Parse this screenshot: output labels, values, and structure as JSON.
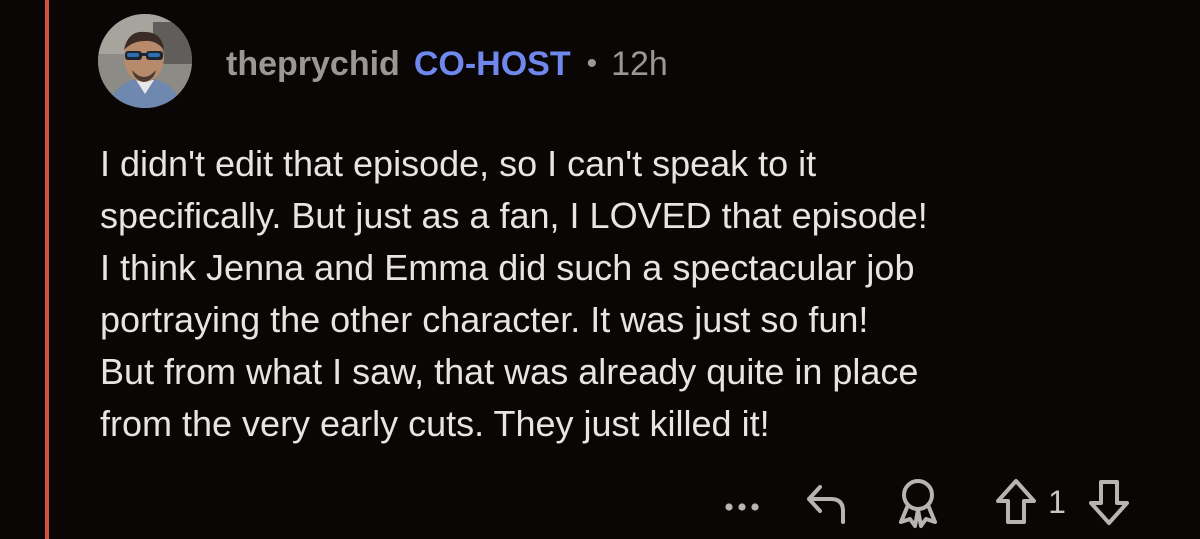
{
  "comment": {
    "author": "theprychid",
    "flair": "CO-HOST",
    "separator": "•",
    "age": "12h",
    "lines": [
      "I didn't edit that episode, so I can't speak to it",
      "specifically. But just as a fan, I LOVED that episode!",
      "I think Jenna and Emma did such a spectacular job",
      "portraying the other character. It was just so fun!",
      "But from what I saw, that was already quite in place",
      "from the very early cuts. They just killed it!"
    ],
    "vote_count": "1"
  },
  "icons": {
    "more": "more-options-icon",
    "reply": "reply-arrow-icon",
    "award": "award-icon",
    "upvote": "upvote-arrow-icon",
    "downvote": "downvote-arrow-icon"
  },
  "colors": {
    "background": "#0b0606",
    "thread_line": "#d6503e",
    "flair": "#6e88ee",
    "muted": "#9a9897",
    "text": "#e8e4e3"
  }
}
